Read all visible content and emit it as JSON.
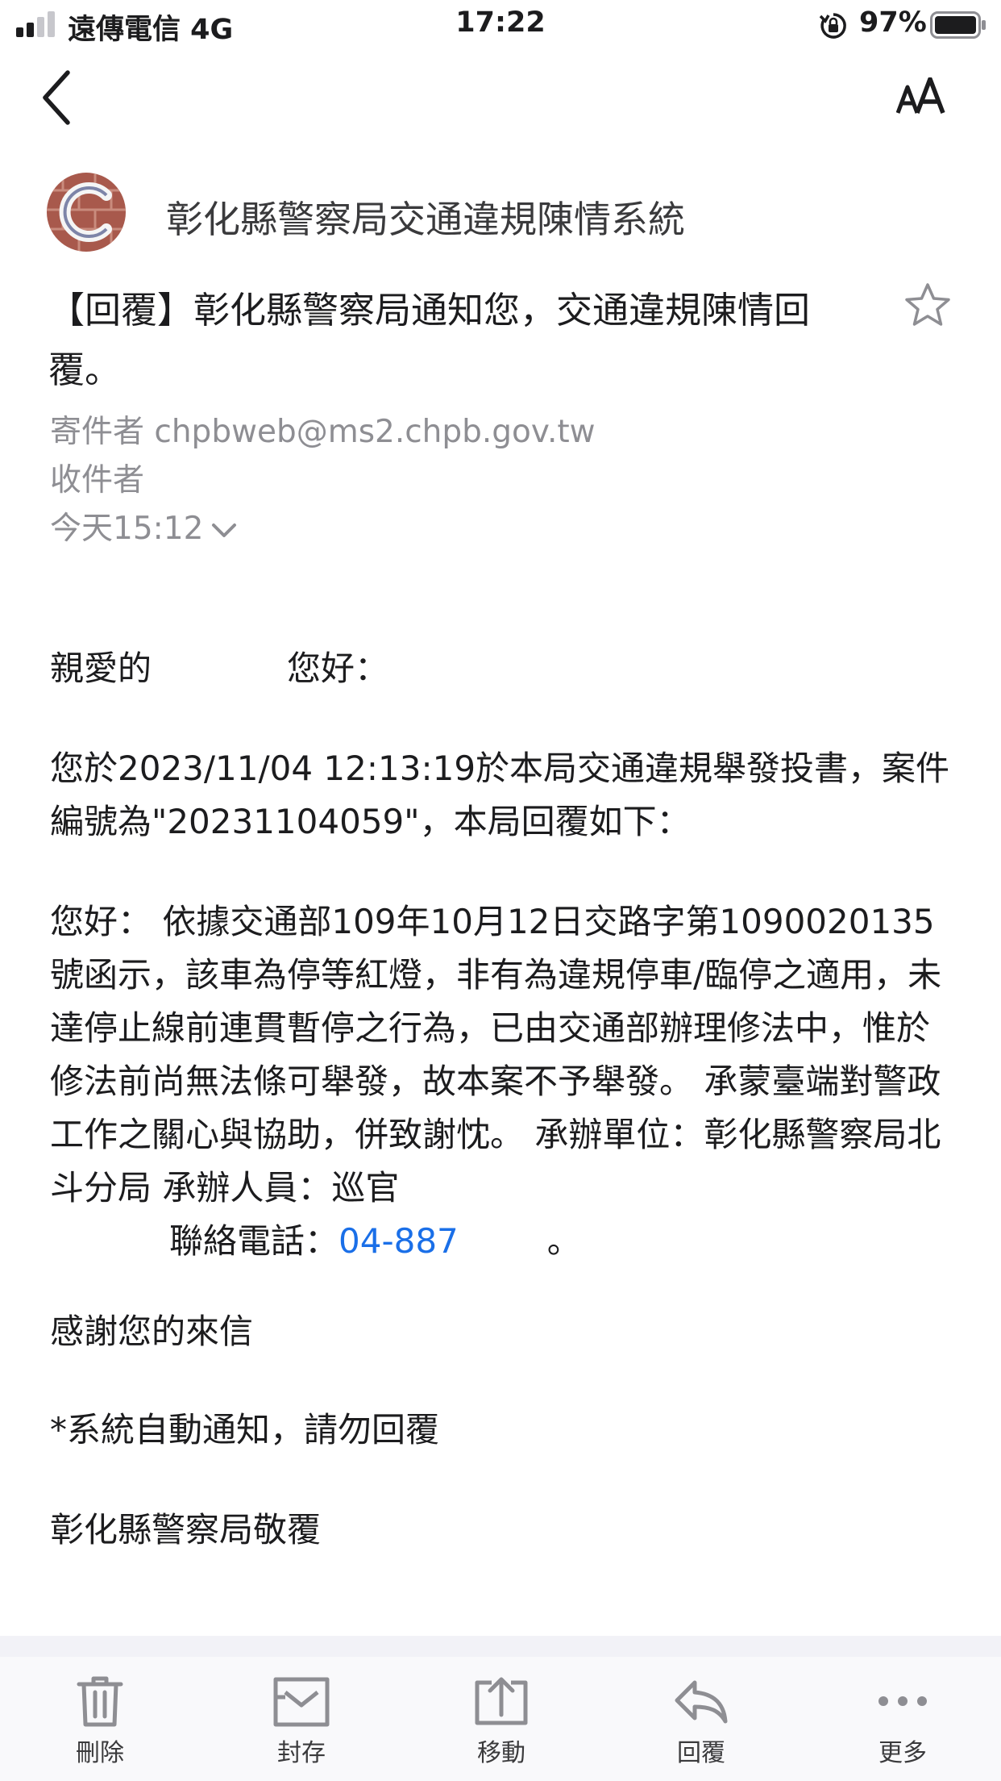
{
  "status_bar": {
    "carrier": "遠傳電信 4G",
    "time": "17:22",
    "battery": "97%"
  },
  "sender": {
    "name": "彰化縣警察局交通違規陳情系統"
  },
  "subject": "【回覆】彰化縣警察局通知您，交通違規陳情回覆。",
  "meta": {
    "from_label": "寄件者 chpbweb@ms2.chpb.gov.tw",
    "to_label": "收件者",
    "date": "今天15:12"
  },
  "body": {
    "greeting_a": "親愛的",
    "greeting_b": "您好：",
    "para1": "您於2023/11/04 12:13:19於本局交通違規舉發投書，案件編號為\"20231104059\"，本局回覆如下：",
    "para2": "您好： 依據交通部109年10月12日交路字第1090020135號函示，該車為停等紅燈，非有為違規停車/臨停之適用，未達停止線前連貫暫停之行為，已由交通部辦理修法中，惟於修法前尚無法條可舉發，故本案不予舉發。 承蒙臺端對警政工作之關心與協助，併致謝忱。 承辦單位：彰化縣警察局北斗分局 承辦人員：巡官",
    "para2_contact": "聯絡電話：",
    "phone": "04-887",
    "para2_end": "。",
    "thanks": "感謝您的來信",
    "auto_notice": "*系統自動通知，請勿回覆",
    "signoff": "彰化縣警察局敬覆"
  },
  "toolbar": {
    "delete": "刪除",
    "archive": "封存",
    "move": "移動",
    "reply": "回覆",
    "more": "更多"
  },
  "colors": {
    "link": "#1a6fe8",
    "meta_gray": "#8e8e93"
  }
}
